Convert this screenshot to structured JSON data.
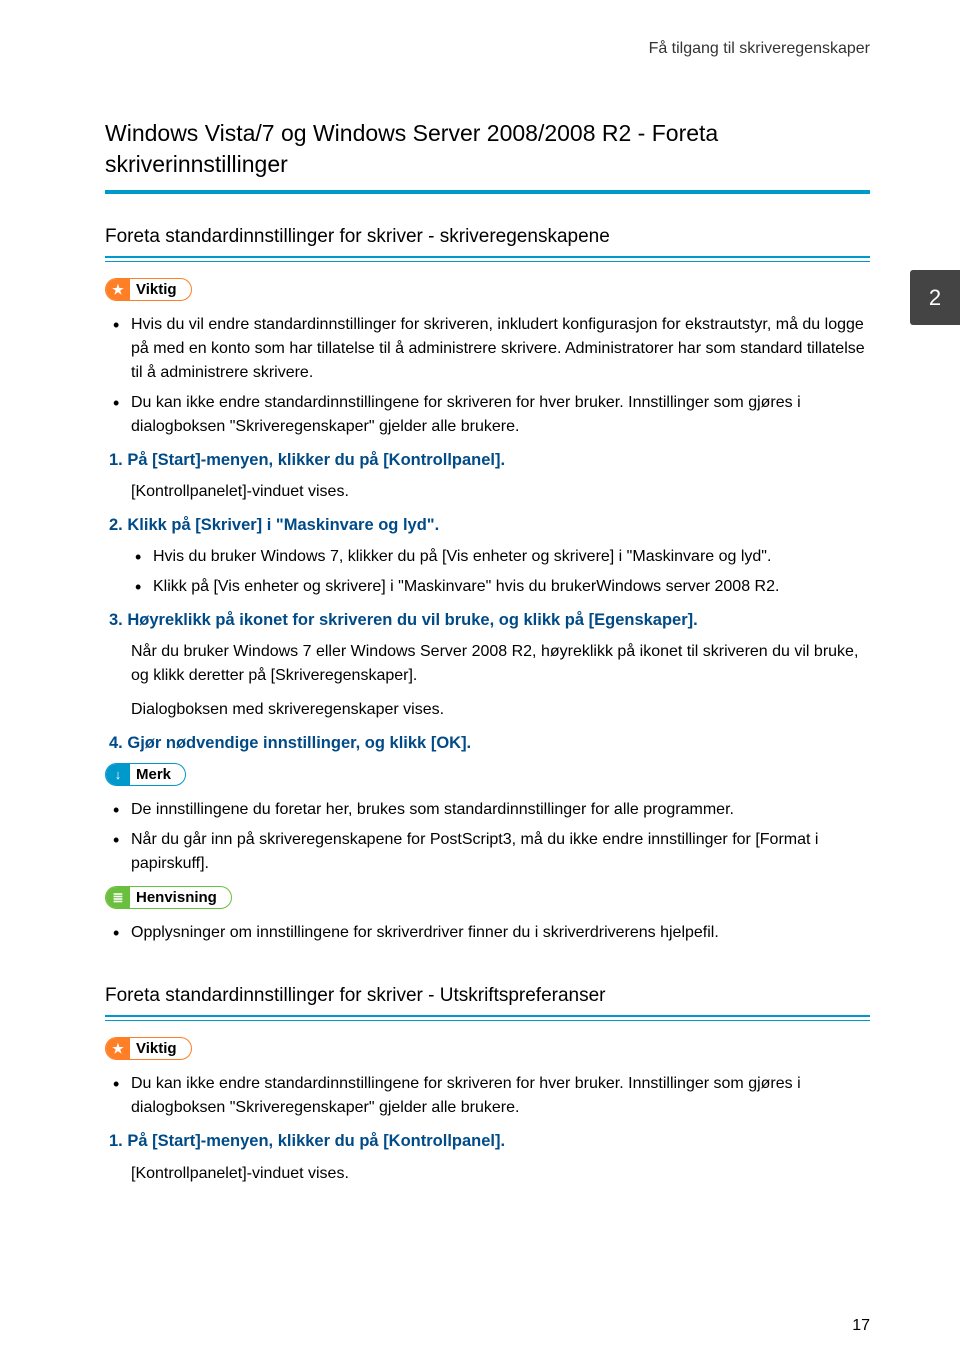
{
  "header": {
    "running_title": "Få tilgang til skriveregenskaper"
  },
  "side_tab": "2",
  "page_number": "17",
  "s1": {
    "heading": "Windows Vista/7 og Windows Server 2008/2008 R2 - Foreta skriverinnstillinger",
    "sub_a": {
      "heading": "Foreta standardinnstillinger for skriver - skriveregenskapene",
      "viktig_label": "Viktig",
      "viktig_items": [
        "Hvis du vil endre standardinnstillinger for skriveren, inkludert konfigurasjon for ekstrautstyr, må du logge på med en konto som har tillatelse til å administrere skrivere. Administratorer har som standard tillatelse til å administrere skrivere.",
        "Du kan ikke endre standardinnstillingene for skriveren for hver bruker. Innstillinger som gjøres i dialogboksen \"Skriveregenskaper\" gjelder alle brukere."
      ],
      "step1_num": "1.",
      "step1_text": "På [Start]-menyen, klikker du på [Kontrollpanel].",
      "step1_detail": "[Kontrollpanelet]-vinduet vises.",
      "step2_num": "2.",
      "step2_text": "Klikk på [Skriver] i \"Maskinvare og lyd\".",
      "step2_sub": [
        "Hvis du bruker Windows 7, klikker du på [Vis enheter og skrivere] i \"Maskinvare og lyd\".",
        "Klikk på [Vis enheter og skrivere] i \"Maskinvare\" hvis du brukerWindows server 2008 R2."
      ],
      "step3_num": "3.",
      "step3_text": "Høyreklikk på ikonet for skriveren du vil bruke, og klikk på [Egenskaper].",
      "step3_detail1": "Når du bruker Windows 7 eller Windows Server 2008 R2, høyreklikk på ikonet til skriveren du vil bruke, og klikk deretter på [Skriveregenskaper].",
      "step3_detail2": "Dialogboksen med skriveregenskaper vises.",
      "step4_num": "4.",
      "step4_text": "Gjør nødvendige innstillinger, og klikk [OK].",
      "merk_label": "Merk",
      "merk_items": [
        "De innstillingene du foretar her, brukes som standardinnstillinger for alle programmer.",
        "Når du går inn på skriveregenskapene for PostScript3, må du ikke endre innstillinger for [Format i papirskuff]."
      ],
      "henvisning_label": "Henvisning",
      "henvisning_items": [
        "Opplysninger om innstillingene for skriverdriver finner du i skriverdriverens hjelpefil."
      ]
    },
    "sub_b": {
      "heading": "Foreta standardinnstillinger for skriver - Utskriftspreferanser",
      "viktig_label": "Viktig",
      "viktig_items": [
        "Du kan ikke endre standardinnstillingene for skriveren for hver bruker. Innstillinger som gjøres i dialogboksen \"Skriveregenskaper\" gjelder alle brukere."
      ],
      "step1_num": "1.",
      "step1_text": "På [Start]-menyen, klikker du på [Kontrollpanel].",
      "step1_detail": "[Kontrollpanelet]-vinduet vises."
    }
  }
}
